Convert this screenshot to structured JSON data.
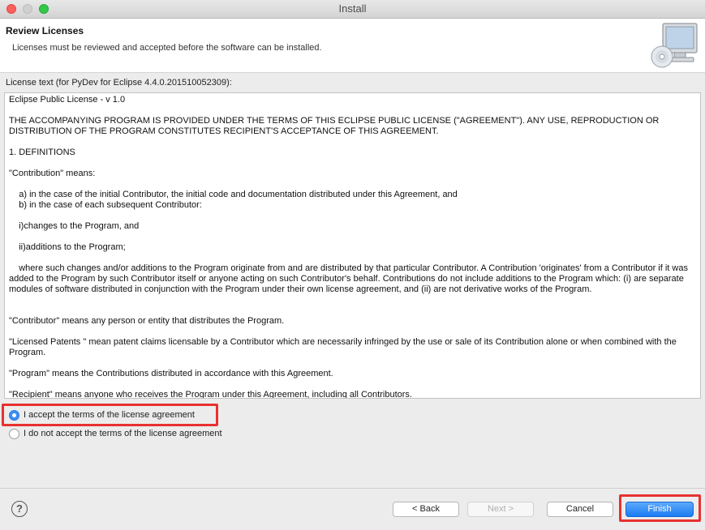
{
  "window": {
    "title": "Install"
  },
  "banner": {
    "heading": "Review Licenses",
    "description": "Licenses must be reviewed and accepted before the software can be installed.",
    "icon": "computer-cd-icon"
  },
  "license": {
    "label": "License text (for PyDev for Eclipse 4.4.0.201510052309):",
    "paragraphs": [
      "Eclipse Public License - v 1.0",
      "THE ACCOMPANYING PROGRAM IS PROVIDED UNDER THE TERMS OF THIS ECLIPSE PUBLIC LICENSE (\"AGREEMENT\"). ANY USE, REPRODUCTION OR DISTRIBUTION OF THE PROGRAM CONSTITUTES RECIPIENT'S ACCEPTANCE OF THIS AGREEMENT.",
      "1. DEFINITIONS",
      "\"Contribution\" means:",
      "    a) in the case of the initial Contributor, the initial code and documentation distributed under this Agreement, and\n    b) in the case of each subsequent Contributor:",
      "    i)changes to the Program, and",
      "    ii)additions to the Program;",
      "    where such changes and/or additions to the Program originate from and are distributed by that particular Contributor. A Contribution 'originates' from a Contributor if it was added to the Program by such Contributor itself or anyone acting on such Contributor's behalf. Contributions do not include additions to the Program which: (i) are separate modules of software distributed in conjunction with the Program under their own license agreement, and (ii) are not derivative works of the Program.",
      "\"Contributor\" means any person or entity that distributes the Program.",
      "\"Licensed Patents \" mean patent claims licensable by a Contributor which are necessarily infringed by the use or sale of its Contribution alone or when combined with the Program.",
      "\"Program\" means the Contributions distributed in accordance with this Agreement.",
      "\"Recipient\" means anyone who receives the Program under this Agreement, including all Contributors."
    ]
  },
  "options": {
    "accept": "I accept the terms of the license agreement",
    "decline": "I do not accept the terms of the license agreement",
    "selected": "accept"
  },
  "buttons": {
    "help": "?",
    "back": "< Back",
    "next": "Next >",
    "cancel": "Cancel",
    "finish": "Finish"
  },
  "colors": {
    "accent": "#1b7cf3",
    "highlight": "#e8312f"
  }
}
